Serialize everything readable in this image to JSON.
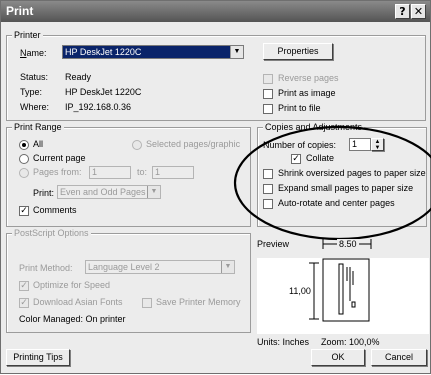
{
  "window": {
    "title": "Print",
    "help_glyph": "?",
    "close_glyph": "✕"
  },
  "printer": {
    "group_label": "Printer",
    "name_label": "Name:",
    "name_value": "HP DeskJet 1220C",
    "properties_button": "Properties",
    "status_label": "Status:",
    "status_value": "Ready",
    "type_label": "Type:",
    "type_value": "HP DeskJet 1220C",
    "where_label": "Where:",
    "where_value": "IP_192.168.0.36",
    "reverse_pages": "Reverse pages",
    "print_as_image": "Print as image",
    "print_to_file": "Print to file"
  },
  "print_range": {
    "group_label": "Print Range",
    "all": "All",
    "selected": "Selected pages/graphic",
    "current_page": "Current page",
    "pages_from": "Pages from:",
    "from_value": "1",
    "to_label": "to:",
    "to_value": "1",
    "print_label": "Print:",
    "print_value": "Even and Odd Pages",
    "comments": "Comments"
  },
  "copies": {
    "group_label": "Copies and Adjustments",
    "number_label": "Number of copies:",
    "number_value": "1",
    "collate": "Collate",
    "shrink": "Shrink oversized pages to paper size",
    "expand": "Expand small pages to paper size",
    "autorotate": "Auto-rotate and center pages"
  },
  "postscript": {
    "group_label": "PostScript Options",
    "method_label": "Print Method:",
    "method_value": "Language Level 2",
    "optimize": "Optimize for Speed",
    "download_fonts": "Download Asian Fonts",
    "save_memory": "Save Printer Memory",
    "color_managed": "Color Managed:  On printer"
  },
  "preview": {
    "label": "Preview",
    "width": "8.50",
    "height": "11,00",
    "units": "Units: Inches",
    "zoom": "Zoom: 100,0%"
  },
  "buttons": {
    "tips": "Printing Tips",
    "ok": "OK",
    "cancel": "Cancel"
  },
  "colors": {
    "titlebar": "#6e6e6e",
    "dialog_bg": "#ececec",
    "annotation": "#000000"
  }
}
